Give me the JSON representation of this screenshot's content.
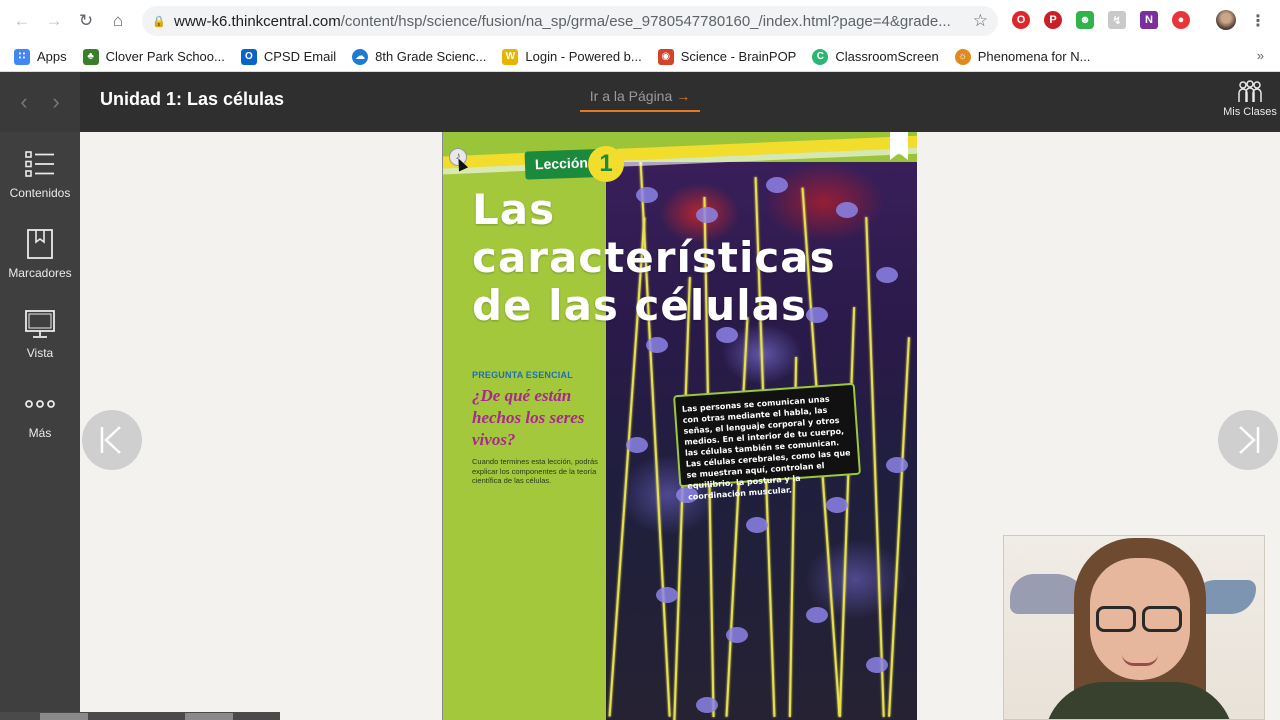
{
  "browser": {
    "url_host": "www-k6.thinkcentral.com",
    "url_path": "/content/hsp/science/fusion/na_sp/grma/ese_9780547780160_/index.html?page=4&grade...",
    "bookmarks": [
      {
        "label": "Apps",
        "icon": "apps-grid-icon",
        "color": "#4285f4"
      },
      {
        "label": "Clover Park Schoo...",
        "icon": "clover-icon",
        "color": "#3a7d2a"
      },
      {
        "label": "CPSD Email",
        "icon": "outlook-icon",
        "color": "#0a64c8"
      },
      {
        "label": "8th Grade Scienc...",
        "icon": "cloud-icon",
        "color": "#1e7bd4"
      },
      {
        "label": "Login - Powered b...",
        "icon": "w-logo-icon",
        "color": "#e8b400"
      },
      {
        "label": "Science - BrainPOP",
        "icon": "brainpop-icon",
        "color": "#d0452a"
      },
      {
        "label": "ClassroomScreen",
        "icon": "classroomscreen-icon",
        "color": "#2bb673"
      },
      {
        "label": "Phenomena for N...",
        "icon": "phenomena-icon",
        "color": "#e08a1a"
      }
    ]
  },
  "app": {
    "unit_title": "Unidad 1: Las células",
    "goto_label": "Ir a la Página",
    "classes_label": "Mis Clases"
  },
  "sidebar": {
    "items": [
      {
        "label": "Contenidos",
        "icon": "list-icon"
      },
      {
        "label": "Marcadores",
        "icon": "bookmark-icon"
      },
      {
        "label": "Vista",
        "icon": "monitor-icon"
      },
      {
        "label": "Más",
        "icon": "more-dots-icon"
      }
    ]
  },
  "page": {
    "lesson_label": "Lección",
    "lesson_number": "1",
    "title_line1": "Las",
    "title_line2": "características",
    "title_line3": "de las células",
    "essential_label": "PREGUNTA ESENCIAL",
    "essential_question": "¿De qué están hechos los seres vivos?",
    "essential_desc": "Cuando termines esta lección, podrás explicar los componentes de la teoría científica de las células.",
    "callout_text": "Las personas se comunican unas con otras mediante el habla, las señas, el lenguaje corporal y otros medios. En el interior de tu cuerpo, las células también se comunican. Las células cerebrales, como las que se muestran aquí, controlan el equilibrio, la postura y la coordinación muscular.",
    "page_num": "4"
  }
}
